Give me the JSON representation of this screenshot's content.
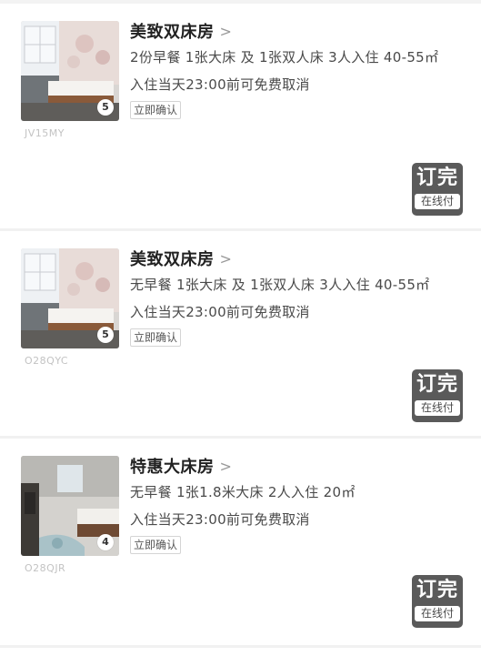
{
  "rooms": [
    {
      "title": "美致双床房",
      "desc": "2份早餐  1张大床 及 1张双人床  3人入住  40-55㎡",
      "cancel": "入住当天23:00前可免费取消",
      "confirm": "立即确认",
      "photo_count": "5",
      "code": "JV15MY",
      "book_main": "订完",
      "book_sub": "在线付"
    },
    {
      "title": "美致双床房",
      "desc": "无早餐  1张大床 及 1张双人床  3人入住  40-55㎡",
      "cancel": "入住当天23:00前可免费取消",
      "confirm": "立即确认",
      "photo_count": "5",
      "code": "O28QYC",
      "book_main": "订完",
      "book_sub": "在线付"
    },
    {
      "title": "特惠大床房",
      "desc": "无早餐  1张1.8米大床  2人入住  20㎡",
      "cancel": "入住当天23:00前可免费取消",
      "confirm": "立即确认",
      "photo_count": "4",
      "code": "O28QJR",
      "book_main": "订完",
      "book_sub": "在线付"
    }
  ],
  "colors": {
    "book_button": "#5a5a5a",
    "code_text": "#c3c3c3",
    "title_text": "#222222"
  },
  "icons": {
    "chevron": "chevron-right-icon"
  }
}
